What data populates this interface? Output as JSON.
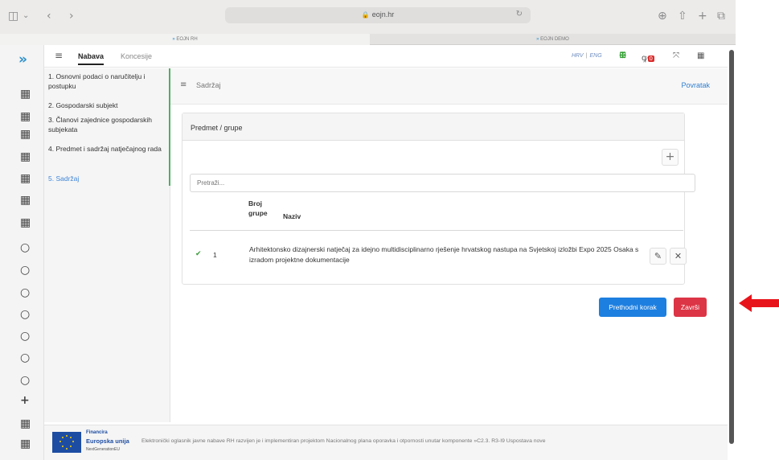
{
  "browser": {
    "url": "eojn.hr",
    "tabs": [
      "EOJN RH",
      "EOJN DEMO"
    ]
  },
  "topnav": {
    "tabs": [
      "Nabava",
      "Koncesije"
    ],
    "lang_hrv": "HRV",
    "lang_eng": "ENG",
    "notif_count": "0"
  },
  "steps": [
    "1. Osnovni podaci o naručitelju i postupku",
    "2. Gospodarski subjekt",
    "3. Članovi zajednice gospodarskih subjekata",
    "4. Predmet i sadržaj natječajnog rada",
    "5. Sadržaj"
  ],
  "content": {
    "title": "Sadržaj",
    "back_label": "Povratak",
    "panel_title": "Predmet / grupe",
    "search_placeholder": "Pretraži...",
    "columns": {
      "broj": "Broj",
      "grupe": "grupe",
      "naziv": "Naziv"
    },
    "rows": [
      {
        "broj": "1",
        "naziv": "Arhitektonsko dizajnerski natječaj za idejno multidisciplinarno rješenje hrvatskog nastupa na Svjetskoj izložbi Expo 2025 Osaka s izradom projektne dokumentacije"
      }
    ],
    "prev_label": "Prethodni korak",
    "finish_label": "Završi"
  },
  "footer": {
    "eu_line1": "Financira",
    "eu_line2": "Europska unija",
    "eu_line3": "NextGenerationEU",
    "text": "Elektronički oglasnik javne nabave RH razvijen je i implementiran projektom Nacionalnog plana oporavka i otpornosti unutar komponente »C2.3. R3-I9 Uspostava nove"
  },
  "colors": {
    "accent_blue": "#1d7fe0",
    "danger_red": "#dc3545",
    "step_active": "#3f86d8",
    "step_done_border": "#4fb060",
    "annotation_arrow": "#e8141b"
  },
  "icons": {
    "rail": [
      "logo-icon",
      "grid-icon",
      "grid-icon",
      "grid-icon",
      "grid-icon",
      "grid-icon",
      "grid-icon",
      "grid-icon",
      "circle-icon",
      "circle-icon",
      "circle-icon",
      "circle-icon",
      "circle-icon",
      "circle-icon",
      "circle-icon",
      "plus-icon",
      "grid-icon",
      "grid-icon"
    ]
  }
}
